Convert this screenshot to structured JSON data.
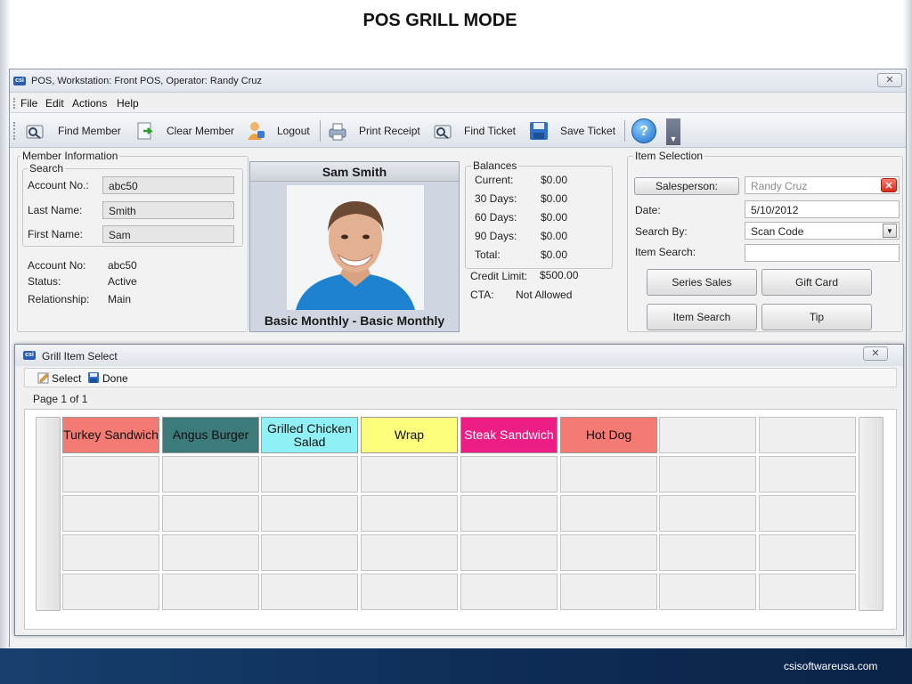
{
  "slide": {
    "title": "POS GRILL MODE",
    "footer": "csisoftwareusa.com"
  },
  "window": {
    "title": "POS, Workstation: Front POS, Operator: Randy Cruz",
    "icon_text": "csi",
    "close_glyph": "✕"
  },
  "menu": [
    "File",
    "Edit",
    "Actions",
    "Help"
  ],
  "toolbar": {
    "find_member": "Find Member",
    "clear_member": "Clear Member",
    "logout": "Logout",
    "print_receipt": "Print Receipt",
    "find_ticket": "Find Ticket",
    "save_ticket": "Save Ticket",
    "help_glyph": "?"
  },
  "member_info": {
    "group_label": "Member Information",
    "search_label": "Search",
    "account_no_label": "Account No.:",
    "account_no_value": "abc50",
    "last_name_label": "Last Name:",
    "last_name_value": "Smith",
    "first_name_label": "First Name:",
    "first_name_value": "Sam",
    "details": {
      "account_label": "Account No:",
      "account_value": "abc50",
      "status_label": "Status:",
      "status_value": "Active",
      "relationship_label": "Relationship:",
      "relationship_value": "Main"
    }
  },
  "member_card": {
    "name": "Sam Smith",
    "plan": "Basic Monthly - Basic Monthly"
  },
  "balances": {
    "group_label": "Balances",
    "rows": [
      {
        "label": "Current:",
        "value": "$0.00"
      },
      {
        "label": "30 Days:",
        "value": "$0.00"
      },
      {
        "label": "60 Days:",
        "value": "$0.00"
      },
      {
        "label": "90 Days:",
        "value": "$0.00"
      },
      {
        "label": "Total:",
        "value": "$0.00"
      }
    ],
    "credit_limit_label": "Credit Limit:",
    "credit_limit_value": "$500.00",
    "cta_label": "CTA:",
    "cta_value": "Not Allowed"
  },
  "item_selection": {
    "group_label": "Item Selection",
    "salesperson_button": "Salesperson:",
    "salesperson_value": "Randy Cruz",
    "date_label": "Date:",
    "date_value": "5/10/2012",
    "search_by_label": "Search By:",
    "search_by_value": "Scan Code",
    "item_search_label": "Item Search:",
    "item_search_value": "",
    "buttons": {
      "series_sales": "Series Sales",
      "gift_card": "Gift Card",
      "item_search": "Item Search",
      "tip": "Tip"
    }
  },
  "grill": {
    "title": "Grill Item Select",
    "select_label": "Select",
    "done_label": "Done",
    "page_label": "Page 1 of 1",
    "items": [
      {
        "label": "Turkey Sandwich",
        "color": "#f47a74",
        "text_color": "#111111"
      },
      {
        "label": "Angus Burger",
        "color": "#3d7a7b",
        "text_color": "#111111"
      },
      {
        "label": "Grilled Chicken Salad",
        "color": "#8ff0f5",
        "text_color": "#111111"
      },
      {
        "label": "Wrap",
        "color": "#fdfd7e",
        "text_color": "#111111"
      },
      {
        "label": "Steak Sandwich",
        "color": "#ec1d83",
        "text_color": "#ffffff"
      },
      {
        "label": "Hot Dog",
        "color": "#f47a74",
        "text_color": "#111111"
      }
    ],
    "empty_tile_color": "#efefef"
  }
}
